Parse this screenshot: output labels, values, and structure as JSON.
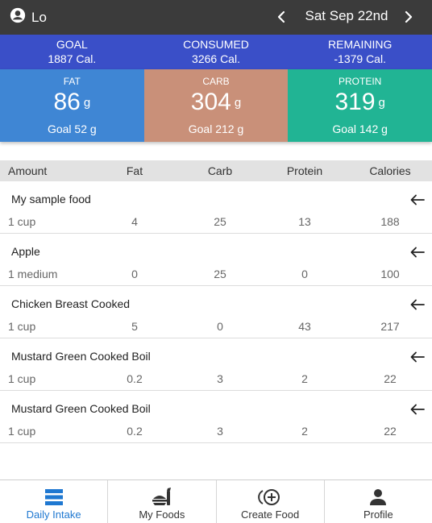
{
  "header": {
    "user_name": "Lo",
    "date": "Sat Sep 22nd"
  },
  "summary": {
    "goal": {
      "label": "GOAL",
      "value": "1887 Cal."
    },
    "consumed": {
      "label": "CONSUMED",
      "value": "3266 Cal."
    },
    "remaining": {
      "label": "REMAINING",
      "value": "-1379 Cal."
    }
  },
  "macros": {
    "fat": {
      "label": "FAT",
      "value": "86",
      "unit": "g",
      "goal": "Goal 52 g",
      "color": "#3f86d4"
    },
    "carb": {
      "label": "CARB",
      "value": "304",
      "unit": "g",
      "goal": "Goal 212 g",
      "color": "#c99079"
    },
    "protein": {
      "label": "PROTEIN",
      "value": "319",
      "unit": "g",
      "goal": "Goal 142 g",
      "color": "#21b494"
    }
  },
  "table": {
    "headers": {
      "amount": "Amount",
      "fat": "Fat",
      "carb": "Carb",
      "protein": "Protein",
      "calories": "Calories"
    },
    "rows": [
      {
        "name": "My sample food",
        "amount": "1 cup",
        "fat": "4",
        "carb": "25",
        "protein": "13",
        "calories": "188"
      },
      {
        "name": "Apple",
        "amount": "1 medium",
        "fat": "0",
        "carb": "25",
        "protein": "0",
        "calories": "100"
      },
      {
        "name": "Chicken Breast Cooked",
        "amount": "1 cup",
        "fat": "5",
        "carb": "0",
        "protein": "43",
        "calories": "217"
      },
      {
        "name": "Mustard Green Cooked Boil",
        "amount": "1 cup",
        "fat": "0.2",
        "carb": "3",
        "protein": "2",
        "calories": "22"
      },
      {
        "name": "Mustard Green Cooked Boil",
        "amount": "1 cup",
        "fat": "0.2",
        "carb": "3",
        "protein": "2",
        "calories": "22"
      }
    ]
  },
  "bottom_nav": [
    {
      "label": "Daily Intake",
      "icon": "menu-list-icon",
      "active": true
    },
    {
      "label": "My Foods",
      "icon": "food-icon",
      "active": false
    },
    {
      "label": "Create Food",
      "icon": "add-circle-icon",
      "active": false
    },
    {
      "label": "Profile",
      "icon": "person-icon",
      "active": false
    }
  ],
  "colors": {
    "topbar": "#3b3b3b",
    "summary": "#3a4fc8",
    "active_tab": "#1f78d1"
  }
}
